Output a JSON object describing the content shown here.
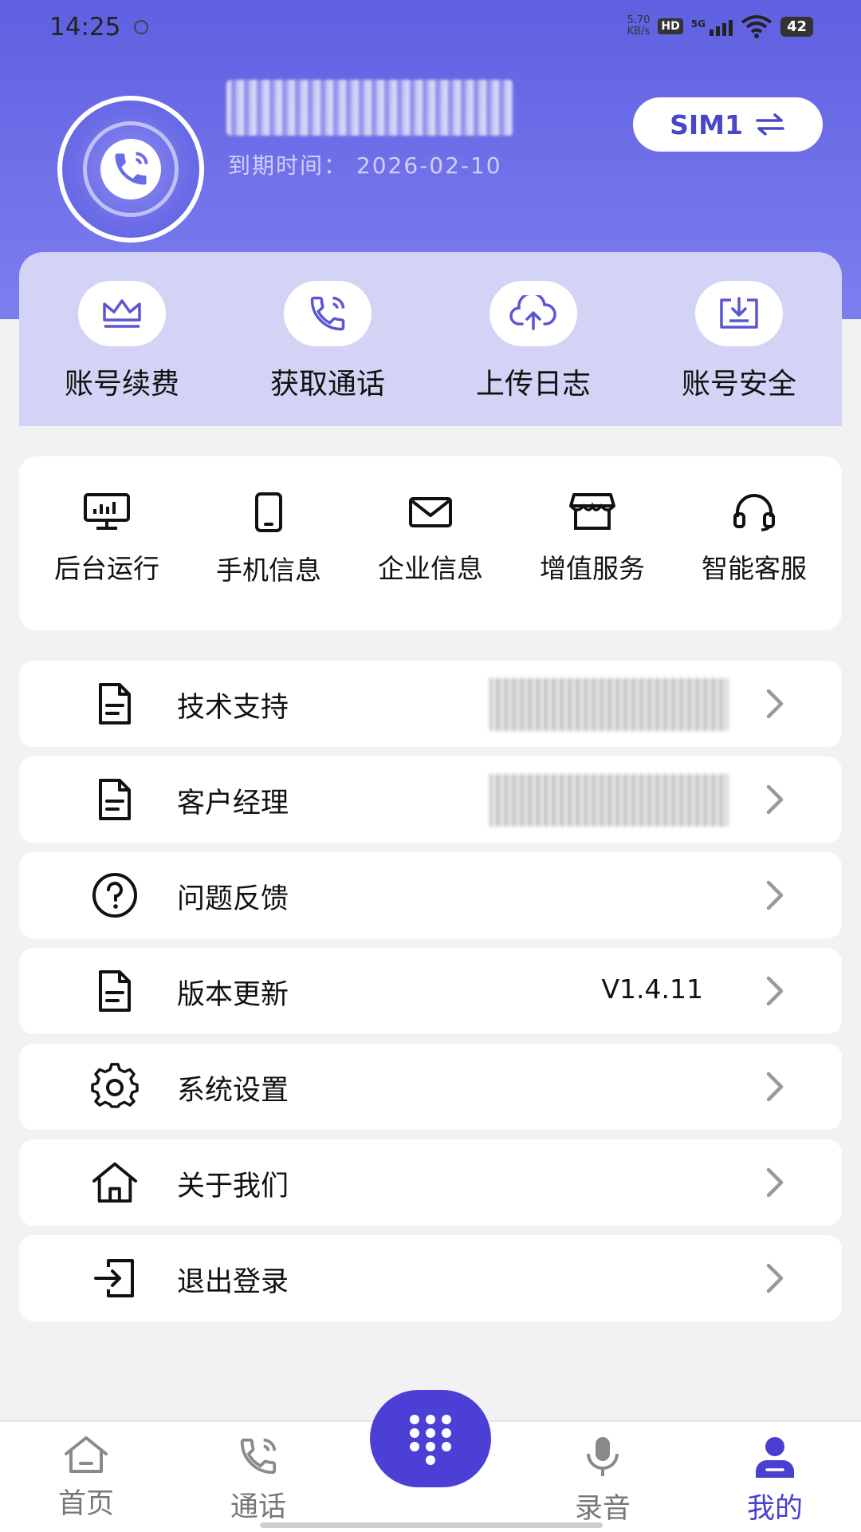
{
  "status_bar": {
    "time": "14:25",
    "net_speed_value": "5.70",
    "net_speed_unit": "KB/s",
    "hd": "HD",
    "network": "5G",
    "battery": "42"
  },
  "header": {
    "expire_label": "到期时间： 2026-02-10",
    "sim_label": "SIM1",
    "sim_icon": "swap-arrows-icon"
  },
  "quick_actions": [
    {
      "label": "账号续费",
      "icon": "crown-icon"
    },
    {
      "label": "获取通话",
      "icon": "phone-call-icon"
    },
    {
      "label": "上传日志",
      "icon": "cloud-upload-icon"
    },
    {
      "label": "账号安全",
      "icon": "download-tray-icon"
    }
  ],
  "grid_items": [
    {
      "label": "后台运行",
      "icon": "monitor-icon"
    },
    {
      "label": "手机信息",
      "icon": "phone-icon"
    },
    {
      "label": "企业信息",
      "icon": "mail-icon"
    },
    {
      "label": "增值服务",
      "icon": "store-icon"
    },
    {
      "label": "智能客服",
      "icon": "headset-icon"
    }
  ],
  "menu": [
    {
      "label": "技术支持",
      "value": "",
      "icon": "document-icon"
    },
    {
      "label": "客户经理",
      "value": "",
      "icon": "document-icon"
    },
    {
      "label": "问题反馈",
      "value": "",
      "icon": "question-icon"
    },
    {
      "label": "版本更新",
      "value": "V1.4.11",
      "icon": "document-icon"
    },
    {
      "label": "系统设置",
      "value": "",
      "icon": "gear-icon"
    },
    {
      "label": "关于我们",
      "value": "",
      "icon": "home-icon"
    },
    {
      "label": "退出登录",
      "value": "",
      "icon": "logout-icon"
    }
  ],
  "tabbar": {
    "home": "首页",
    "calls": "通话",
    "recordings": "录音",
    "mine": "我的",
    "active": "mine"
  },
  "colors": {
    "accent": "#4b3fd6",
    "header_top": "#5f60e0",
    "quick_card_bg": "#d3d3f6"
  }
}
